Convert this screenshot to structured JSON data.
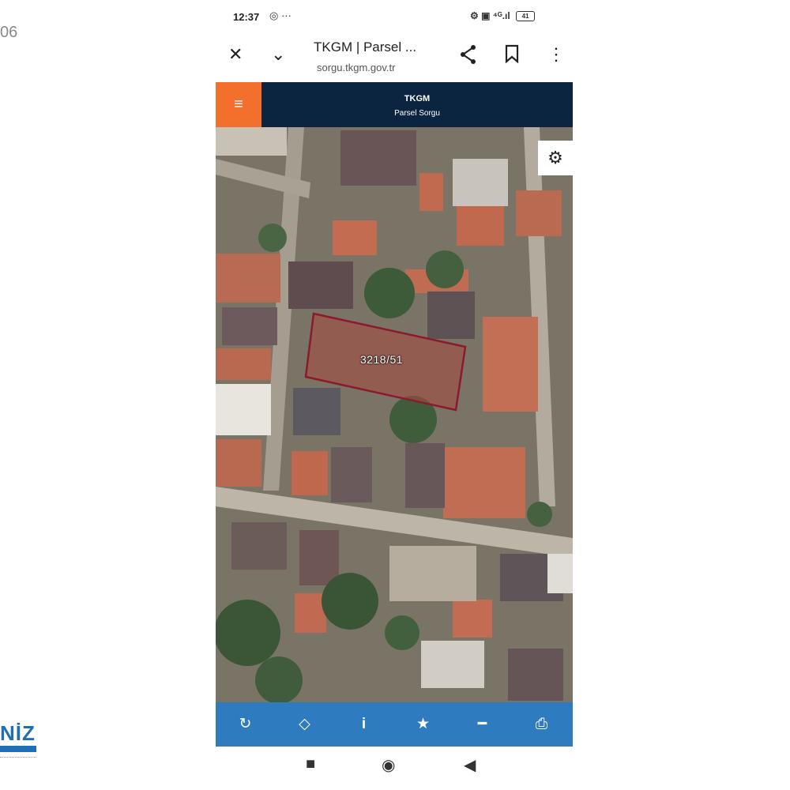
{
  "corner": {
    "time_fragment": "06",
    "logo_text": "NİZ"
  },
  "status_bar": {
    "time": "12:37",
    "left_icons": "◎ ···",
    "right_icons": "⚙ ▣ ⁴ᴳ.ıl",
    "battery": "41"
  },
  "browser": {
    "title": "TKGM | Parsel ...",
    "url": "sorgu.tkgm.gov.tr",
    "close_icon": "close-icon",
    "collapse_icon": "chevron-down-icon",
    "share_icon": "share-icon",
    "bookmark_icon": "bookmark-icon",
    "more_icon": "more-vertical-icon"
  },
  "app": {
    "title": "TKGM",
    "subtitle": "Parsel Sorgu",
    "accent": "#f36f2c",
    "header_bg": "#0b2440"
  },
  "map": {
    "parcel_label": "3218/51",
    "parcel_outline_color": "#8b1a2b"
  },
  "toolbar": {
    "bg": "#2f7bc0",
    "items": [
      {
        "icon": "refresh-icon",
        "glyph": "↻"
      },
      {
        "icon": "locate-icon",
        "glyph": "◇"
      },
      {
        "icon": "info-icon",
        "glyph": "i"
      },
      {
        "icon": "star-icon",
        "glyph": "★"
      },
      {
        "icon": "measure-icon",
        "glyph": "━"
      },
      {
        "icon": "print-icon",
        "glyph": "⎙"
      }
    ]
  },
  "nav": {
    "recents": "■",
    "home": "◉",
    "back": "◀"
  }
}
